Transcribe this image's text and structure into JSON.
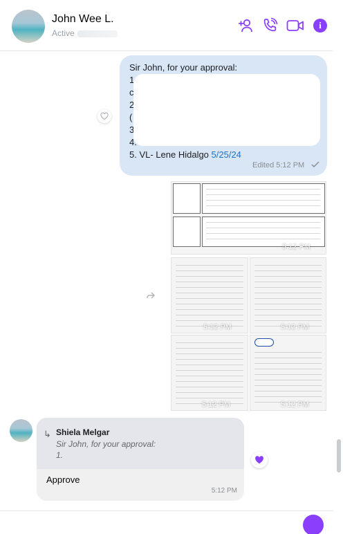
{
  "header": {
    "contact_name": "John Wee L.",
    "status": "Active",
    "icons": [
      "add-person-icon",
      "phone-icon",
      "video-icon",
      "info-icon"
    ],
    "info_glyph": "i",
    "accent_color": "#8a3ffc"
  },
  "outgoing_message": {
    "lines": [
      {
        "text": "Sir John, for your approval:"
      },
      {
        "text": "1"
      },
      {
        "text": "c"
      },
      {
        "text": "2"
      },
      {
        "text": "("
      },
      {
        "text": "3"
      },
      {
        "text": "4."
      },
      {
        "text_prefix": "5. VL- Lene Hidalgo ",
        "date": "5/25/24"
      }
    ],
    "edited_label": "Edited 5:12 PM"
  },
  "images": [
    {
      "time": "5:12 PM"
    },
    {
      "time": "5:12 PM"
    },
    {
      "time": "5:12 PM"
    },
    {
      "time": "5:12 PM"
    },
    {
      "time": "5:12 PM"
    }
  ],
  "reply": {
    "sender": "Shiela Melgar",
    "quote_line1": "Sir John, for your approval:",
    "quote_line2": "1. ",
    "text": "Approve",
    "time": "5:12 PM",
    "reaction_icon": "heart-icon"
  }
}
